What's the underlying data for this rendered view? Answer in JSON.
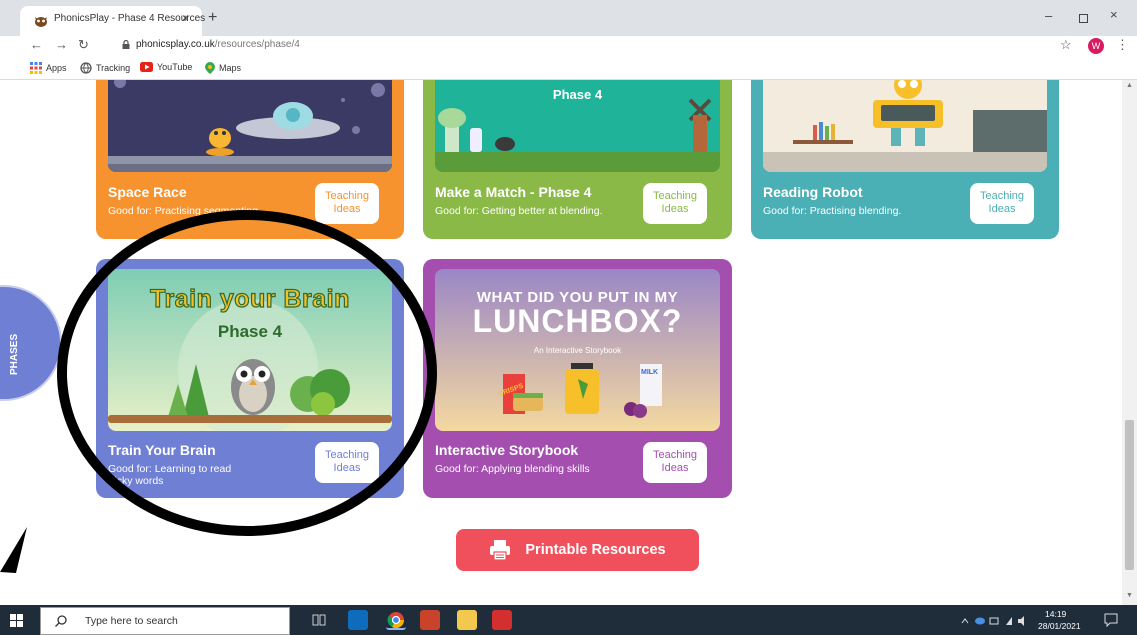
{
  "browser": {
    "tab_title": "PhonicsPlay - Phase 4 Resources",
    "tab_close": "×",
    "new_tab": "+",
    "url_host": "phonicsplay.co.uk",
    "url_path": "/resources/phase/4",
    "profile_initial": "W",
    "window_min": "–",
    "window_close": "×"
  },
  "bookmarks": [
    {
      "label": "Apps"
    },
    {
      "label": "Tracking"
    },
    {
      "label": "YouTube"
    },
    {
      "label": "Maps"
    }
  ],
  "cards": {
    "space_race": {
      "title": "Space Race",
      "subtitle": "Good for: Practising segmenting.",
      "button": "Teaching Ideas",
      "color": "#f7932f"
    },
    "make_a_match": {
      "title": "Make a Match - Phase 4",
      "subtitle": "Good for: Getting better at blending.",
      "button": "Teaching Ideas",
      "color": "#8bb948",
      "art_label": "Phase 4"
    },
    "reading_robot": {
      "title": "Reading Robot",
      "subtitle": "Good for: Practising blending.",
      "button": "Teaching Ideas",
      "color": "#4bb0b5"
    },
    "train_your_brain": {
      "title": "Train Your Brain",
      "subtitle": "Good for: Learning to read tricky words",
      "button": "Teaching Ideas",
      "color": "#6e7fd4",
      "art_title": "Train your Brain",
      "art_phase": "Phase 4"
    },
    "storybook": {
      "title": "Interactive Storybook",
      "subtitle": "Good for: Applying blending skills",
      "button": "Teaching Ideas",
      "color": "#a44fb0",
      "art_line1": "WHAT DID YOU PUT IN MY",
      "art_line2": "LUNCHBOX?",
      "art_caption": "An Interactive Storybook",
      "crisps": "CRISPS",
      "milk": "MILK"
    }
  },
  "printable_label": "Printable Resources",
  "phases_tab_label": "PHASES",
  "taskbar": {
    "search_placeholder": "Type here to search",
    "time": "14:19",
    "date": "28/01/2021"
  }
}
